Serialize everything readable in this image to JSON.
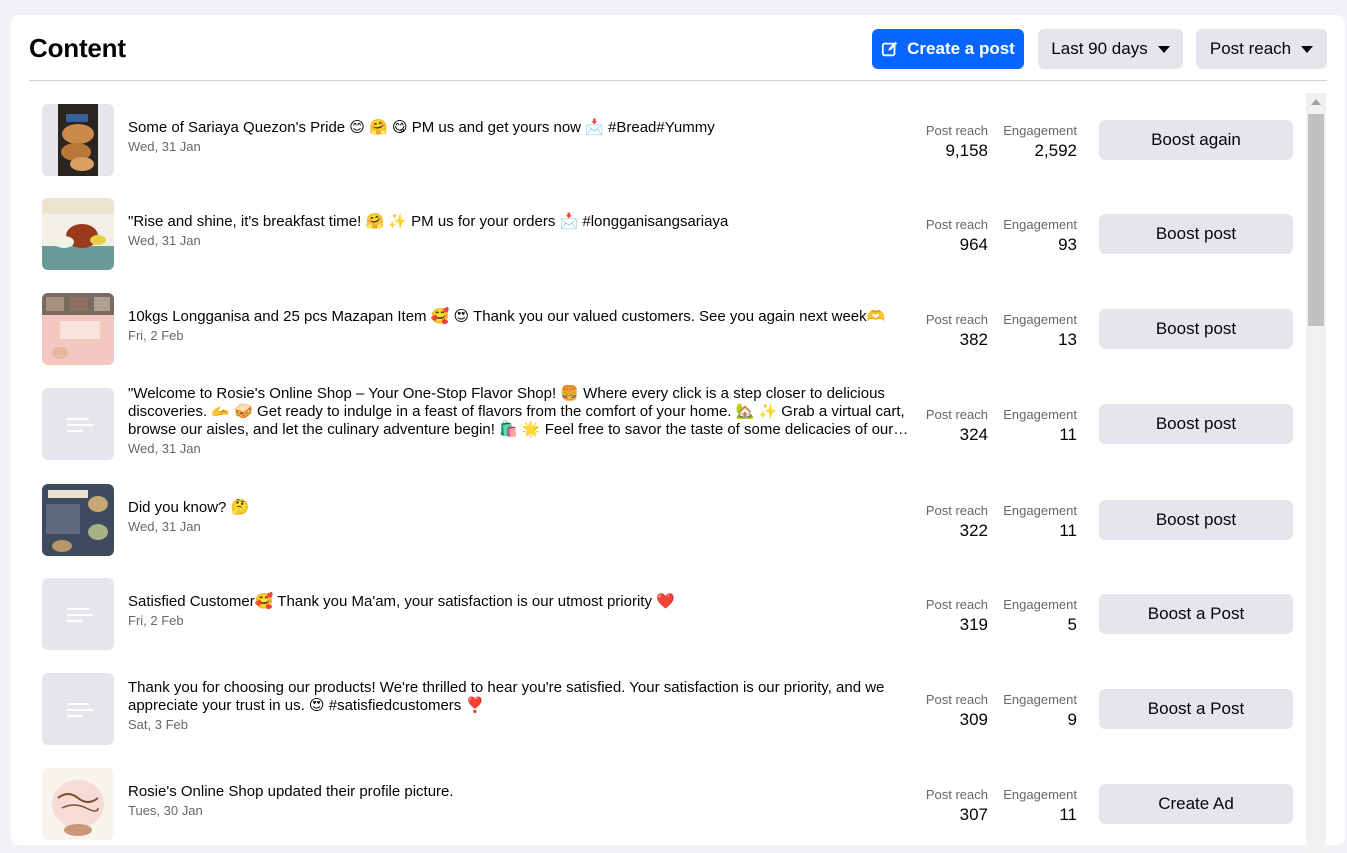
{
  "header": {
    "title": "Content",
    "create_post_label": "Create a post",
    "filter_period": "Last 90 days",
    "sort_metric": "Post reach"
  },
  "colors": {
    "primary": "#0866ff",
    "button_bg": "#e4e6eb",
    "muted_text": "#65676b"
  },
  "metric_labels": {
    "reach": "Post reach",
    "engagement": "Engagement"
  },
  "posts": [
    {
      "message": "Some of Sariaya Quezon's Pride 😊 🤗 😋 PM us and get yours now 📩 #Bread#Yummy",
      "date": "Wed, 31 Jan",
      "reach": "9,158",
      "engagement": "2,592",
      "action": "Boost again",
      "thumb": "bread-photo"
    },
    {
      "message": "\"Rise and shine, it's breakfast time! 🤗 ✨ PM us for your orders 📩 #longganisangsariaya",
      "date": "Wed, 31 Jan",
      "reach": "964",
      "engagement": "93",
      "action": "Boost post",
      "thumb": "breakfast-photo"
    },
    {
      "message": "10kgs Longganisa and 25 pcs Mazapan Item 🥰 😍 Thank you our valued customers. See you again next week🫶",
      "date": "Fri, 2 Feb",
      "reach": "382",
      "engagement": "13",
      "action": "Boost post",
      "thumb": "thank-you-photo"
    },
    {
      "message": "\"Welcome to Rosie's Online Shop – Your One-Stop Flavor Shop! 🍔 Where every click is a step closer to delicious discoveries. 🫴 🥪 Get ready to indulge in a feast of flavors from the comfort of your home. 🏡 ✨ Grab a virtual cart, browse our aisles, and let the culinary adventure begin! 🛍️ 🌟 Feel free to savor the taste of some delicacies of our…",
      "date": "Wed, 31 Jan",
      "reach": "324",
      "engagement": "11",
      "action": "Boost post",
      "thumb": "placeholder"
    },
    {
      "message": "Did you know? 🤔",
      "date": "Wed, 31 Jan",
      "reach": "322",
      "engagement": "11",
      "action": "Boost post",
      "thumb": "did-you-know-photo"
    },
    {
      "message": "Satisfied Customer🥰 Thank you Ma'am, your satisfaction is our utmost priority ❤️",
      "date": "Fri, 2 Feb",
      "reach": "319",
      "engagement": "5",
      "action": "Boost a Post",
      "thumb": "placeholder"
    },
    {
      "message": "Thank you for choosing our products! We're thrilled to hear you're satisfied. Your satisfaction is our priority, and we appreciate your trust in us. 😍 #satisfiedcustomers ❣️",
      "date": "Sat, 3 Feb",
      "reach": "309",
      "engagement": "9",
      "action": "Boost a Post",
      "thumb": "placeholder"
    },
    {
      "message": "Rosie's Online Shop updated their profile picture.",
      "date": "Tues, 30 Jan",
      "reach": "307",
      "engagement": "11",
      "action": "Create Ad",
      "thumb": "profile-picture"
    }
  ]
}
